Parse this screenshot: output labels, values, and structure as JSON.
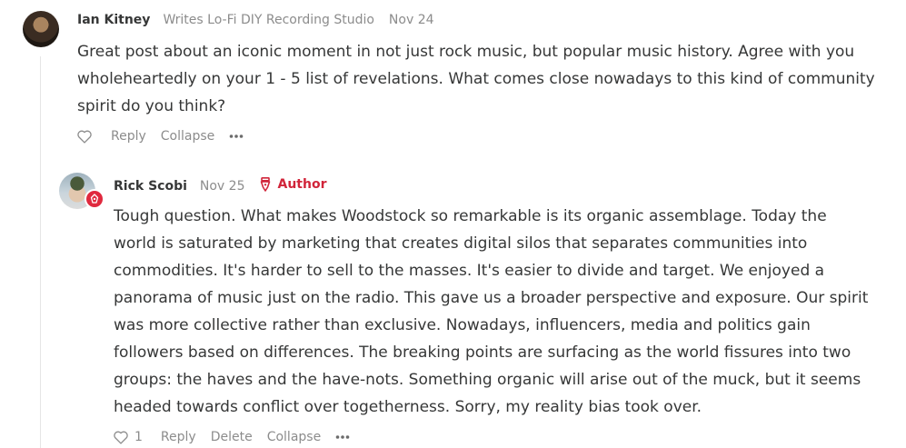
{
  "comments": [
    {
      "author": "Ian Kitney",
      "subtitle": "Writes Lo-Fi DIY Recording Studio",
      "date": "Nov 24",
      "body_lines": [
        "Great post about an iconic moment in not just rock music, but popular music history. Agree with you",
        "wholeheartedly on your 1 - 5 list of revelations. What comes close nowadays to this kind of community",
        "spirit do you think?"
      ],
      "actions": {
        "reply": "Reply",
        "collapse": "Collapse",
        "more": "•••"
      }
    },
    {
      "author": "Rick Scobi",
      "date": "Nov 25",
      "author_badge": "Author",
      "body_lines": [
        "Tough question. What makes Woodstock so remarkable is its organic assemblage. Today the",
        "world is saturated by marketing that creates digital silos that separates communities into",
        "commodities. It's harder to sell to the masses. It's easier to divide and target. We enjoyed a",
        "panorama of music just on the radio. This gave us a broader perspective and exposure. Our spirit",
        "was more collective rather than exclusive. Nowadays, influencers, media and politics gain",
        "followers based on differences. The breaking points are surfacing as the world fissures into two",
        "groups: the haves and the have-nots. Something organic will arise out of the muck, but it seems",
        "headed towards conflict over togetherness. Sorry, my reality bias took over."
      ],
      "actions": {
        "like_count": "1",
        "reply": "Reply",
        "delete": "Delete",
        "collapse": "Collapse",
        "more": "•••"
      }
    }
  ],
  "icons": {
    "heart": "heart-icon",
    "more": "more-icon",
    "pen": "pen-nib-icon"
  },
  "colors": {
    "author_accent": "#d1253a",
    "muted_text": "#8c8c8c",
    "body_text": "#363737"
  }
}
